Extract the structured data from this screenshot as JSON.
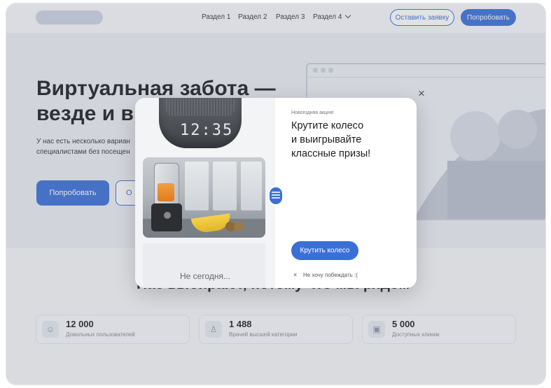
{
  "header": {
    "nav": [
      "Раздел 1",
      "Раздел 2",
      "Раздел 3",
      "Раздел 4"
    ],
    "request_label": "Оставить заявку",
    "try_label": "Попробовать"
  },
  "hero": {
    "title": "Виртуальная забота —\nвезде и в",
    "subtitle": "У нас есть несколько вариан\nспециалистами без посещен",
    "try_label": "Попробовать",
    "second_label": "О"
  },
  "section": {
    "title": "Нас выбирают, потому что мы рядом"
  },
  "stats": [
    {
      "number": "12 000",
      "label": "Довольных пользователей",
      "icon": "smile-icon"
    },
    {
      "number": "1 488",
      "label": "Врачей высшей категории",
      "icon": "doctor-icon"
    },
    {
      "number": "5 000",
      "label": "Доступных клиник",
      "icon": "clinic-icon"
    }
  ],
  "mockup": {
    "close_glyph": "×"
  },
  "modal": {
    "clock": "12:35",
    "tag": "Новогодняя акция!",
    "title": "Крутите колесо\nи выигрывайте\nклассные призы!",
    "spin_label": "Крутить колесо",
    "decline_icon": "×",
    "decline_label": "Не хочу побеждать :(",
    "not_today": "Не сегодня..."
  },
  "colors": {
    "accent": "#3a6fd8"
  }
}
